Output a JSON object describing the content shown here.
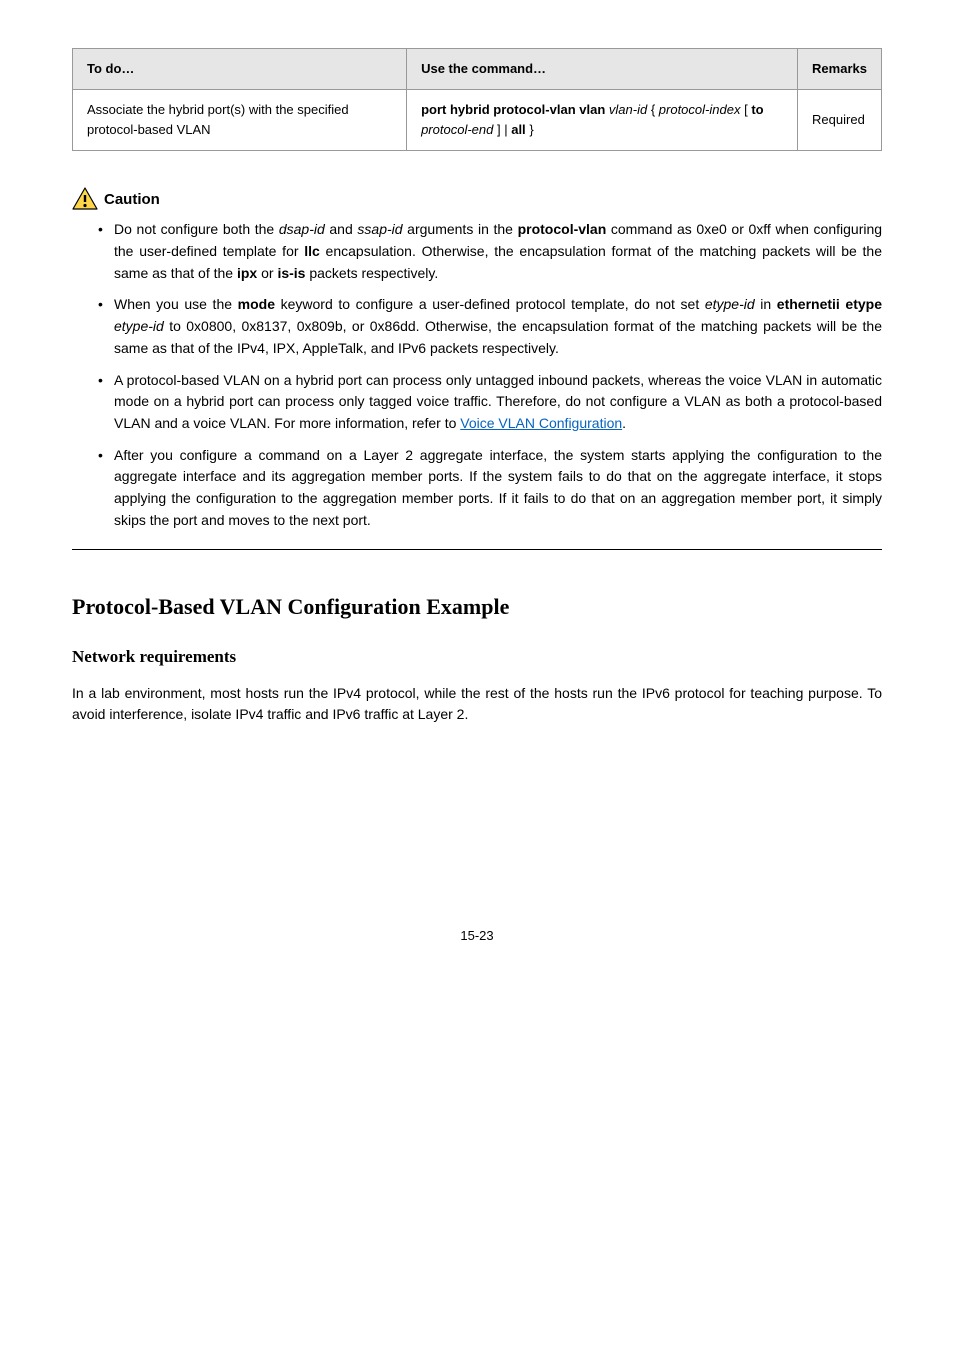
{
  "table": {
    "headers": [
      "To do…",
      "Use the command…",
      "Remarks"
    ],
    "row": {
      "desc": "Associate the hybrid port(s) with the specified protocol-based VLAN",
      "cmd_parts": {
        "p1": "port hybrid protocol-vlan vlan",
        "a1": "vlan-id",
        "open": "{",
        "a2": "protocol-index",
        "open2": "[",
        "p2": "to",
        "a3": "protocol-end",
        "close2": "] |",
        "p3": "all",
        "close": "}"
      },
      "remark": "Required"
    }
  },
  "caution": {
    "label": "Caution",
    "items": [
      {
        "parts": [
          {
            "t": "Do not configure both the "
          },
          {
            "t": "dsap-id",
            "cls": "arg"
          },
          {
            "t": " and "
          },
          {
            "t": "ssap-id",
            "cls": "arg"
          },
          {
            "t": " arguments in the "
          },
          {
            "t": "protocol-vlan",
            "cls": "kw"
          },
          {
            "t": " command as 0xe0 or 0xff when configuring the user-defined template for "
          },
          {
            "t": "llc",
            "cls": "kw"
          },
          {
            "t": " encapsulation. Otherwise, the encapsulation format of the matching packets will be the same as that of the "
          },
          {
            "t": "ipx",
            "cls": "kw"
          },
          {
            "t": " or "
          },
          {
            "t": "is-is",
            "cls": "kw"
          },
          {
            "t": " packets respectively."
          }
        ]
      },
      {
        "parts": [
          {
            "t": "When you use the "
          },
          {
            "t": "mode",
            "cls": "kw"
          },
          {
            "t": " keyword to configure a user-defined protocol template, do not set "
          },
          {
            "t": "etype-id",
            "cls": "arg"
          },
          {
            "t": " in "
          },
          {
            "t": "ethernetii etype",
            "cls": "kw"
          },
          {
            "t": " "
          },
          {
            "t": "etype-id",
            "cls": "arg"
          },
          {
            "t": " to 0x0800, 0x8137,  0x809b, or 0x86dd. Otherwise, the encapsulation format of the matching packets will be the same as that of the IPv4, IPX, AppleTalk, and IPv6 packets respectively."
          }
        ]
      },
      {
        "parts": [
          {
            "t": "A protocol-based VLAN on a hybrid port can process only untagged inbound packets, whereas the voice VLAN in automatic mode on a hybrid port can process only tagged voice traffic. Therefore, do not configure a VLAN as both a protocol-based VLAN and a voice VLAN. For more information, refer to "
          },
          {
            "t": "Voice VLAN Configuration",
            "cls": "link"
          },
          {
            "t": "."
          }
        ]
      },
      {
        "parts": [
          {
            "t": "After you configure a command on a Layer 2 aggregate interface, the system starts applying the configuration to the aggregate interface and its aggregation member ports. If the system fails to do that on the aggregate interface, it stops applying the configuration to the aggregation member ports. If it fails to do that on an aggregation member port, it simply skips the port and moves to the next port."
          }
        ]
      }
    ]
  },
  "section": {
    "title": "Protocol-Based VLAN Configuration Example",
    "subtitle": "Network requirements",
    "para": "In a lab environment, most hosts run the IPv4 protocol, while the rest of the hosts run the IPv6 protocol for teaching purpose. To avoid interference, isolate IPv4 traffic and IPv6 traffic at Layer 2."
  },
  "pagenum": "15-23"
}
